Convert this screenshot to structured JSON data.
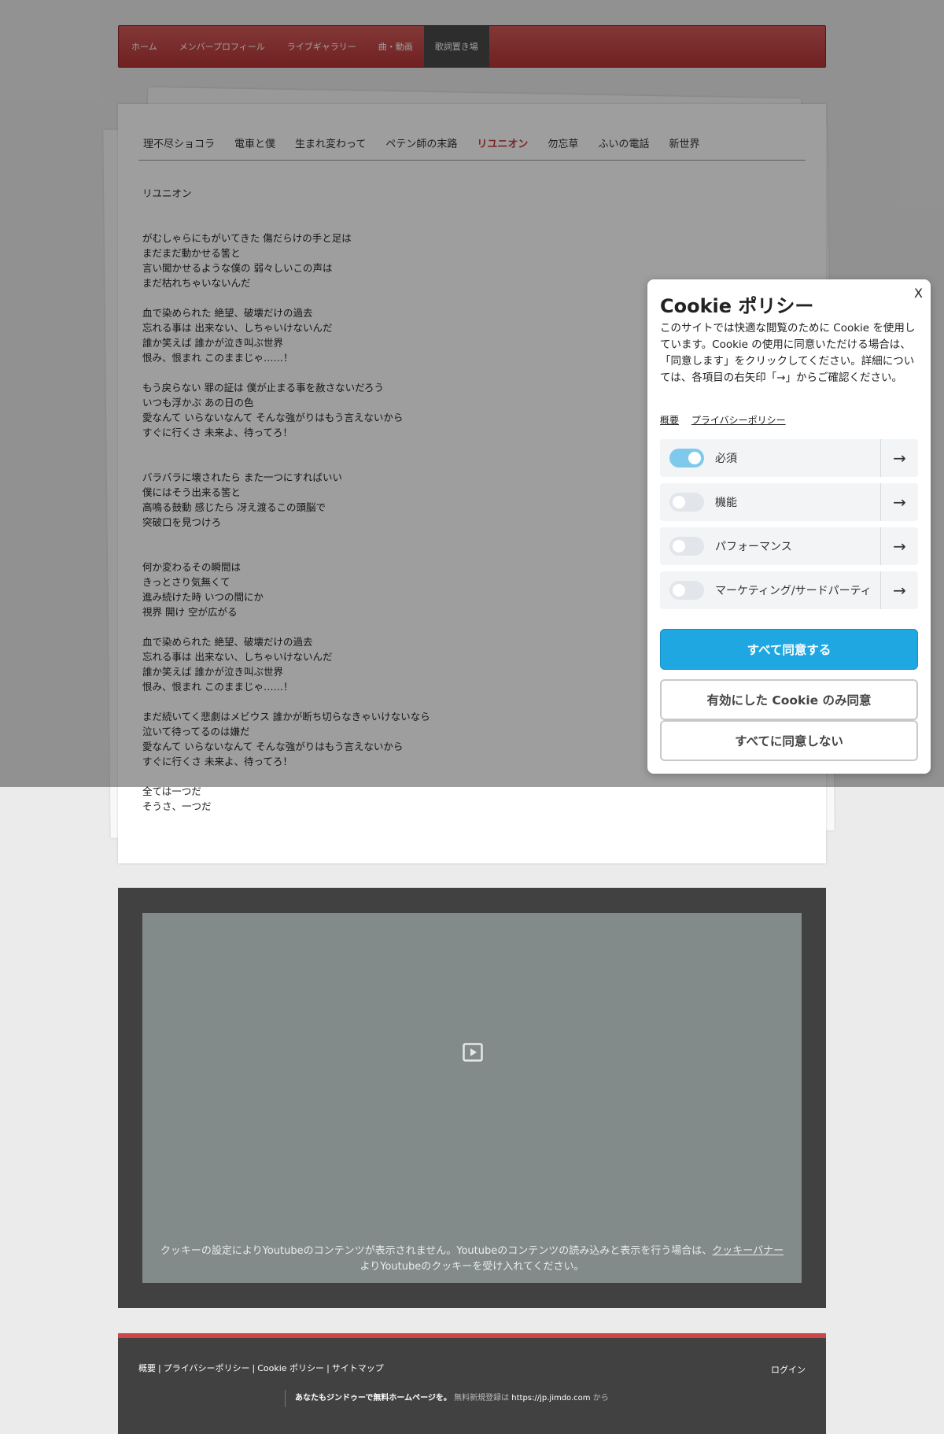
{
  "nav": {
    "items": [
      {
        "label": "ホーム",
        "active": false
      },
      {
        "label": "メンバープロフィール",
        "active": false
      },
      {
        "label": "ライブギャラリー",
        "active": false
      },
      {
        "label": "曲・動画",
        "active": false
      },
      {
        "label": "歌詞置き場",
        "active": true
      }
    ]
  },
  "subnav": {
    "items": [
      {
        "label": "理不尽ショコラ",
        "active": false
      },
      {
        "label": "電車と僕",
        "active": false
      },
      {
        "label": "生まれ変わって",
        "active": false
      },
      {
        "label": "ペテン師の末路",
        "active": false
      },
      {
        "label": "リユニオン",
        "active": true
      },
      {
        "label": "勿忘草",
        "active": false
      },
      {
        "label": "ふいの電話",
        "active": false
      },
      {
        "label": "新世界",
        "active": false
      }
    ]
  },
  "lyrics": {
    "title": "リユニオン",
    "stanzas": [
      {
        "lines": [
          "がむしゃらにもがいてきた 傷だらけの手と足は",
          "まだまだ動かせる筈と",
          "言い聞かせるような僕の 弱々しいこの声は",
          "まだ枯れちゃいないんだ"
        ]
      },
      {
        "lines": [
          "血で染められた 絶望、破壊だけの過去",
          "忘れる事は 出来ない、しちゃいけないんだ",
          "誰か笑えば 誰かが泣き叫ぶ世界",
          "恨み、恨まれ このままじゃ……！"
        ]
      },
      {
        "lines": [
          "もう戻らない 罪の証は 僕が止まる事を赦さないだろう",
          "いつも浮かぶ あの日の色",
          "愛なんて いらないなんて そんな強がりはもう言えないから",
          "すぐに行くさ 未来よ、待ってろ！"
        ]
      },
      {
        "lines": [
          "バラバラに壊されたら また一つにすればいい",
          "僕にはそう出来る筈と",
          "高鳴る鼓動 感じたら 冴え渡るこの頭脳で",
          "突破口を見つけろ"
        ]
      },
      {
        "lines": [
          "何か変わるその瞬間は",
          "きっとさり気無くて",
          "進み続けた時 いつの間にか",
          "視界 開け 空が広がる"
        ]
      },
      {
        "lines": [
          "血で染められた 絶望、破壊だけの過去",
          "忘れる事は 出来ない、しちゃいけないんだ",
          "誰か笑えば 誰かが泣き叫ぶ世界",
          "恨み、恨まれ このままじゃ……！"
        ]
      },
      {
        "lines": [
          "まだ続いてく悲劇はメビウス 誰かが断ち切らなきゃいけないなら",
          "泣いて待ってるのは嫌だ",
          "愛なんて いらないなんて そんな強がりはもう言えないから",
          "すぐに行くさ 未来よ、待ってろ！"
        ]
      },
      {
        "lines": [
          "全ては一つだ",
          "そうさ、一つだ"
        ]
      }
    ]
  },
  "video": {
    "note_text": "クッキーの設定によりYoutubeのコンテンツが表示されません。Youtubeのコンテンツの読み込みと表示を行う場合は、",
    "note_link": "クッキーバナー",
    "note_suffix": "よりYoutubeのクッキーを受け入れてください。",
    "icon": "play-icon"
  },
  "footer": {
    "links": [
      "概要",
      "プライバシーポリシー",
      "Cookie ポリシー",
      "サイトマップ"
    ],
    "separator": "|",
    "login": "ログイン",
    "promo_bold": "あなたもジンドゥーで無料ホームページを。",
    "promo_text": " 無料新規登録は ",
    "promo_url": "https://jp.jimdo.com",
    "promo_suffix": " から",
    "accent_color": "#cf4545"
  },
  "cookie": {
    "close": "X",
    "title": "Cookie ポリシー",
    "description": "このサイトでは快適な閲覧のために Cookie を使用しています。Cookie の使用に同意いただける場合は、「同意します」をクリックしてください。詳細については、各項目の右矢印「→」からご確認ください。",
    "links": [
      "概要",
      "プライバシーポリシー"
    ],
    "categories": [
      {
        "label": "必須",
        "enabled": true
      },
      {
        "label": "機能",
        "enabled": false
      },
      {
        "label": "パフォーマンス",
        "enabled": false
      },
      {
        "label": "マーケティング/サードパーティ",
        "enabled": false
      }
    ],
    "arrow": "→",
    "accept_all": "すべて同意する",
    "accept_selected": "有効にした Cookie のみ同意",
    "reject_all": "すべてに同意しない",
    "accent_color": "#1ea7e1"
  }
}
